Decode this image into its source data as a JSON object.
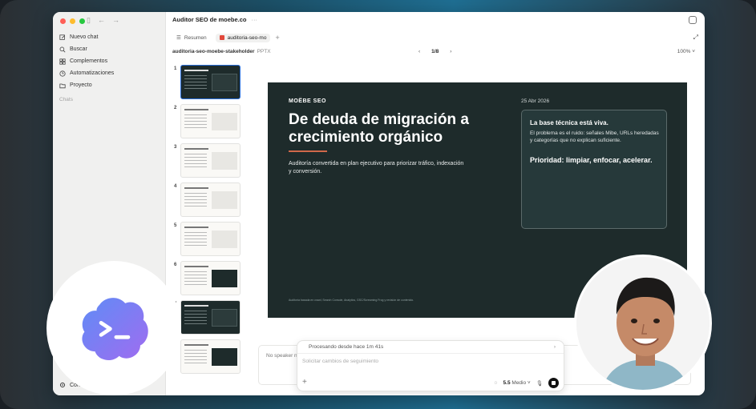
{
  "window": {
    "title": "Auditor SEO de moebe.co",
    "title_more": "···"
  },
  "sidebar": {
    "items": [
      {
        "label": "Nuevo chat",
        "icon": "compose-icon"
      },
      {
        "label": "Buscar",
        "icon": "search-icon"
      },
      {
        "label": "Complementos",
        "icon": "grid-icon"
      },
      {
        "label": "Automatizaciones",
        "icon": "clock-icon"
      },
      {
        "label": "Proyecto",
        "icon": "folder-icon"
      }
    ],
    "section_label": "Chats",
    "config_label": "Config"
  },
  "tabs": [
    {
      "label": "Resumen",
      "active": false
    },
    {
      "label": "auditoria-seo-mo",
      "active": true
    }
  ],
  "file": {
    "name": "auditoria-seo-moebe-stakeholder",
    "type": "PPTX",
    "page": "1/8",
    "zoom": "100%"
  },
  "thumbnails": [
    "1",
    "2",
    "3",
    "4",
    "5",
    "6",
    "7",
    "8"
  ],
  "slide": {
    "brand": "MOËBE SEO",
    "date": "25 Abr 2026",
    "title": "De deuda de migración a crecimiento orgánico",
    "subtitle": "Auditoría convertida en plan ejecutivo para priorizar tráfico, indexación y conversión.",
    "card_heading": "La base técnica está viva.",
    "card_body": "El problema es el ruido: señales Mibe, URLs heredadas y categorías que no explican suficiente.",
    "card_emphasis": "Prioridad: limpiar, enfocar, acelerar.",
    "footer": "Auditoría basada en crawl, Search Console, Analytics, GSC/Screaming Frog y revisión de contenido."
  },
  "notes": {
    "placeholder": "No speaker notes"
  },
  "composer": {
    "processing": "Procesando desde hace 1m 41s",
    "placeholder": "Solicitar cambios de seguimiento",
    "model": "5.5",
    "effort": "Medio"
  },
  "colors": {
    "slide_bg": "#1e2b2b",
    "accent_rule": "#d0684a",
    "app_icon_gradient": [
      "#6a8ff5",
      "#9a6df0"
    ]
  }
}
